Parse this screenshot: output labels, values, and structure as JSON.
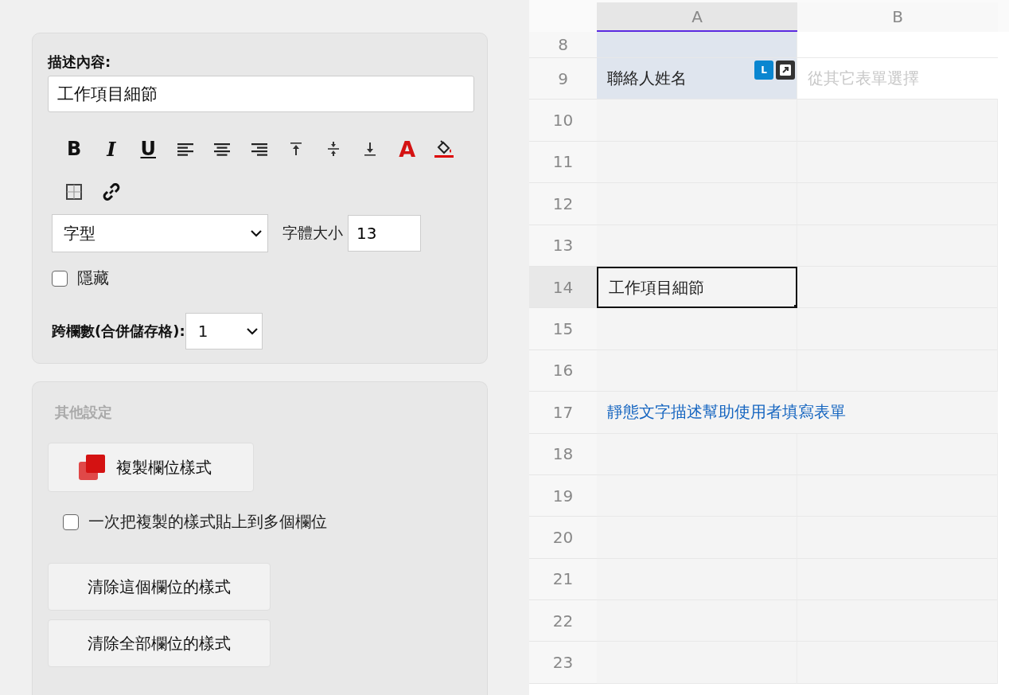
{
  "properties": {
    "description_label": "描述內容:",
    "description_value": "工作項目細節",
    "toolbar": [
      {
        "kind": "bold",
        "label": "B"
      },
      {
        "kind": "italic",
        "label": "I"
      },
      {
        "kind": "underline",
        "label": "U"
      },
      {
        "kind": "align-left"
      },
      {
        "kind": "align-center"
      },
      {
        "kind": "align-right"
      },
      {
        "kind": "valign-top"
      },
      {
        "kind": "valign-middle"
      },
      {
        "kind": "valign-bottom"
      },
      {
        "kind": "font-color",
        "label": "A"
      },
      {
        "kind": "fill-color"
      },
      {
        "kind": "borders"
      },
      {
        "kind": "link"
      }
    ],
    "font_select": "字型",
    "font_size_label": "字體大小",
    "font_size_value": "13",
    "hidden": {
      "label": "隱藏",
      "checked": false
    },
    "colspan_label": "跨欄數(合併儲存格):",
    "colspan_value": "1"
  },
  "other_settings": {
    "title": "其他設定",
    "copy_style_button": "複製欄位樣式",
    "multi_paste": {
      "label": "一次把複製的樣式貼上到多個欄位",
      "checked": false
    },
    "buttons": [
      "清除這個欄位的樣式",
      "清除全部欄位的樣式"
    ]
  },
  "sheet": {
    "columns": [
      {
        "label": "A",
        "selected": true
      },
      {
        "label": "B",
        "selected": false
      }
    ],
    "rows": [
      {
        "number": "8",
        "kind": "partial",
        "selected": false
      },
      {
        "number": "9",
        "kind": "field",
        "label": "聯絡人姓名",
        "hint": "從其它表單選擇",
        "badge": "L",
        "selected": false
      },
      {
        "number": "10",
        "kind": "empty",
        "selected": false
      },
      {
        "number": "11",
        "kind": "empty",
        "selected": false
      },
      {
        "number": "12",
        "kind": "empty",
        "selected": false
      },
      {
        "number": "13",
        "kind": "empty",
        "selected": false
      },
      {
        "number": "14",
        "kind": "text",
        "label": "工作項目細節",
        "selected": true
      },
      {
        "number": "15",
        "kind": "empty",
        "selected": false
      },
      {
        "number": "16",
        "kind": "empty",
        "selected": false
      },
      {
        "number": "17",
        "kind": "static",
        "label": "靜態文字描述幫助使用者填寫表單",
        "selected": false
      },
      {
        "number": "18",
        "kind": "empty",
        "selected": false
      },
      {
        "number": "19",
        "kind": "empty",
        "selected": false
      },
      {
        "number": "20",
        "kind": "empty",
        "selected": false
      },
      {
        "number": "21",
        "kind": "empty",
        "selected": false
      },
      {
        "number": "22",
        "kind": "empty",
        "selected": false
      },
      {
        "number": "23",
        "kind": "empty",
        "selected": false
      }
    ]
  }
}
